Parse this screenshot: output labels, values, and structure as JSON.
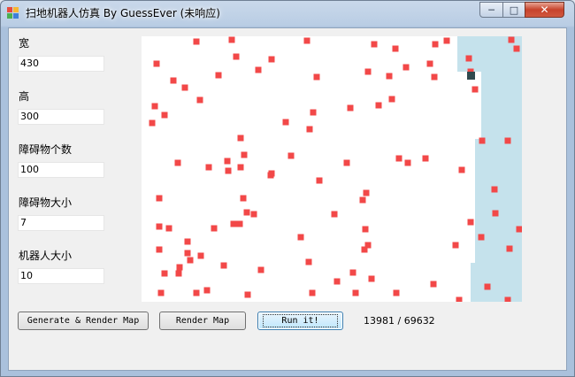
{
  "window": {
    "title": "扫地机器人仿真 By GuessEver (未响应)",
    "controls": {
      "minimize": "─",
      "maximize": "□",
      "close": "✕"
    }
  },
  "fields": [
    {
      "label": "宽",
      "value": "430"
    },
    {
      "label": "高",
      "value": "300"
    },
    {
      "label": "障碍物个数",
      "value": "100"
    },
    {
      "label": "障碍物大小",
      "value": "7"
    },
    {
      "label": "机器人大小",
      "value": "10"
    }
  ],
  "map": {
    "obstacle_color": "#f24848",
    "cleaned_color": "#c5e2ec",
    "robot_color": "#2f4a4f"
  },
  "buttons": {
    "generate": "Generate & Render Map",
    "render": "Render Map",
    "run": "Run it!"
  },
  "status": {
    "progress": "13981 / 69632"
  }
}
